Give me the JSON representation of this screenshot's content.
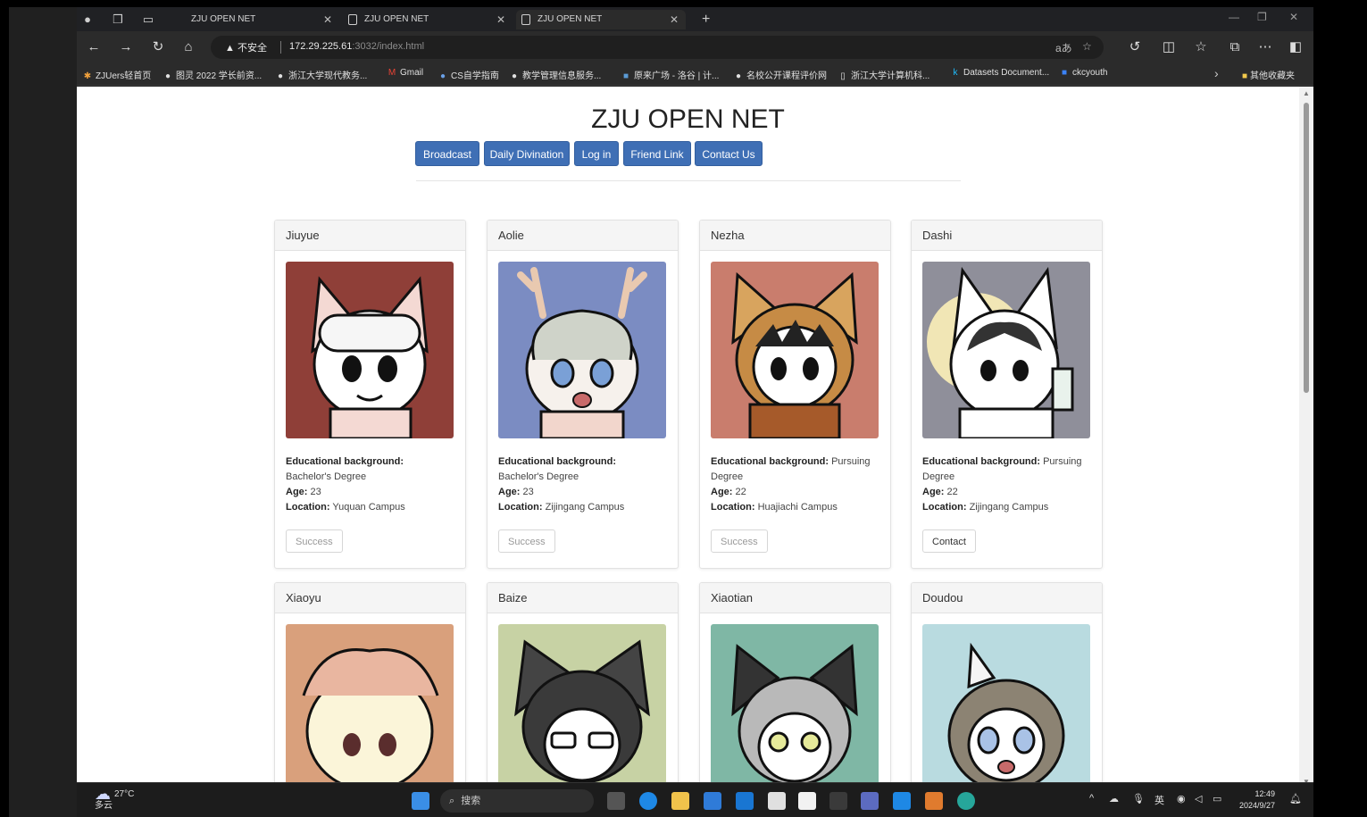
{
  "browser": {
    "tabs": [
      {
        "title": "ZJU OPEN NET"
      },
      {
        "title": "ZJU OPEN NET"
      },
      {
        "title": "ZJU OPEN NET"
      }
    ],
    "address": {
      "security": "不安全",
      "url_host": "172.29.225.61",
      "url_rest": ":3032/index.html"
    },
    "bookmarks": [
      {
        "label": "ZJUers轻首页"
      },
      {
        "label": "图灵 2022 学长前资..."
      },
      {
        "label": "浙江大学现代教务..."
      },
      {
        "label": "Gmail"
      },
      {
        "label": "CS自学指南"
      },
      {
        "label": "教学管理信息服务..."
      },
      {
        "label": "原来广场 - 洛谷 | 计..."
      },
      {
        "label": "名校公开课程评价网"
      },
      {
        "label": "浙江大学计算机科..."
      },
      {
        "label": "Datasets Document..."
      },
      {
        "label": "ckcyouth"
      }
    ],
    "bookmarks_folder": "其他收藏夹"
  },
  "page": {
    "title": "ZJU OPEN NET",
    "menu": [
      {
        "label": "Broadcast"
      },
      {
        "label": "Daily Divination"
      },
      {
        "label": "Log in"
      },
      {
        "label": "Friend Link"
      },
      {
        "label": "Contact Us"
      }
    ],
    "labels": {
      "edu": "Educational background:",
      "age": "Age:",
      "loc": "Location:"
    },
    "cards": [
      {
        "name": "Jiuyue",
        "edu": "Bachelor's Degree",
        "age": "23",
        "location": "Yuquan Campus",
        "button": "Success",
        "color": "#8f3f38"
      },
      {
        "name": "Aolie",
        "edu": "Bachelor's Degree",
        "age": "23",
        "location": "Zijingang Campus",
        "button": "Success",
        "color": "#7b8cc2"
      },
      {
        "name": "Nezha",
        "edu": "Pursuing Degree",
        "age": "22",
        "location": "Huajiachi Campus",
        "button": "Success",
        "color": "#c97d6d"
      },
      {
        "name": "Dashi",
        "edu": "Pursuing Degree",
        "age": "22",
        "location": "Zijingang Campus",
        "button": "Contact",
        "color": "#8f8f9a"
      },
      {
        "name": "Xiaoyu",
        "color": "#d9a07c"
      },
      {
        "name": "Baize",
        "color": "#c7d2a4"
      },
      {
        "name": "Xiaotian",
        "color": "#7fb7a5"
      },
      {
        "name": "Doudou",
        "color": "#b9dbe0"
      }
    ]
  },
  "taskbar": {
    "temp": "27°C",
    "weather": "多云",
    "search": "搜索",
    "ime": "英",
    "time": "12:49",
    "date": "2024/9/27"
  }
}
